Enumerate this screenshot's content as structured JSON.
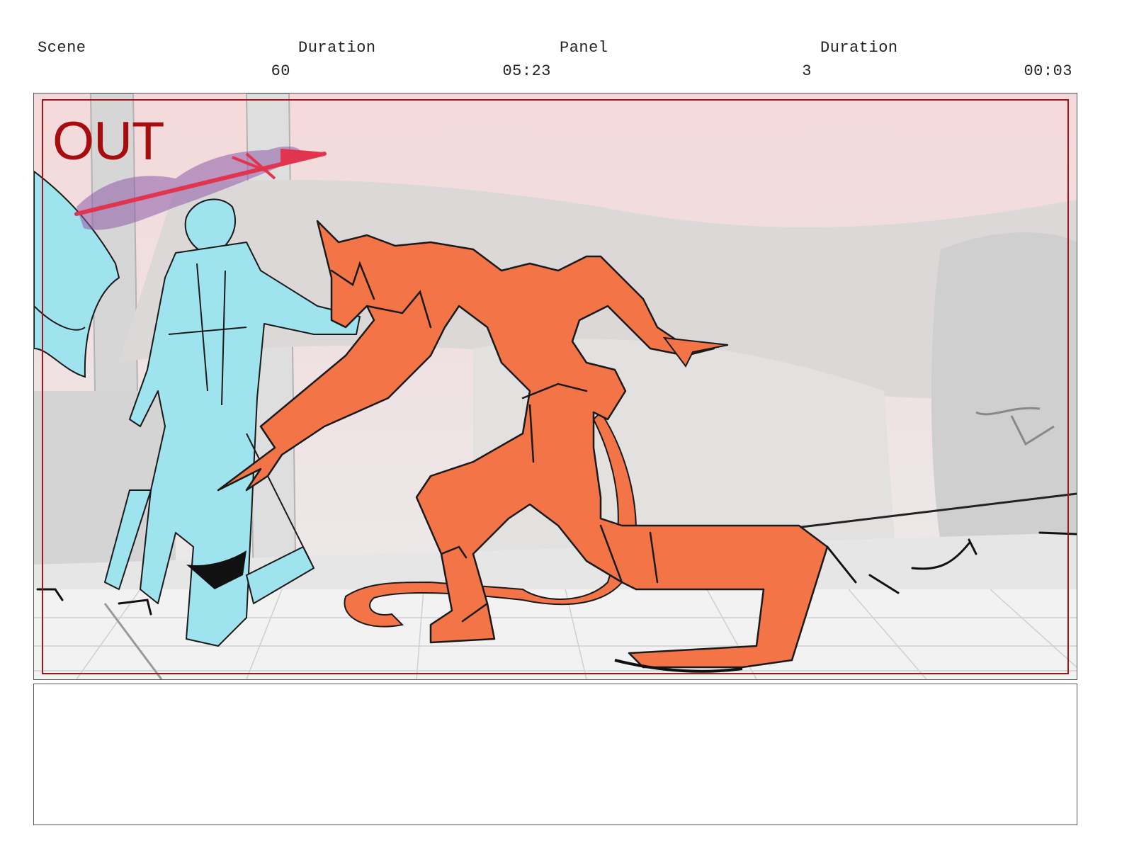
{
  "header": {
    "scene_label": "Scene",
    "scene_value": "60",
    "scene_duration_label": "Duration",
    "scene_duration_value": "05:23",
    "panel_label": "Panel",
    "panel_value": "3",
    "panel_duration_label": "Duration",
    "panel_duration_value": "00:03"
  },
  "panel": {
    "stamp_text": "OUT",
    "stamp_color": "#a80d0d",
    "safe_frame_color": "#a3151a"
  },
  "colors": {
    "figure_left": "#9fe3ee",
    "figure_right": "#f27447",
    "sky_tint": "#f3dadb",
    "ground": "#f1f1f1",
    "spear": "#e0344f"
  },
  "notes": {
    "text": ""
  }
}
